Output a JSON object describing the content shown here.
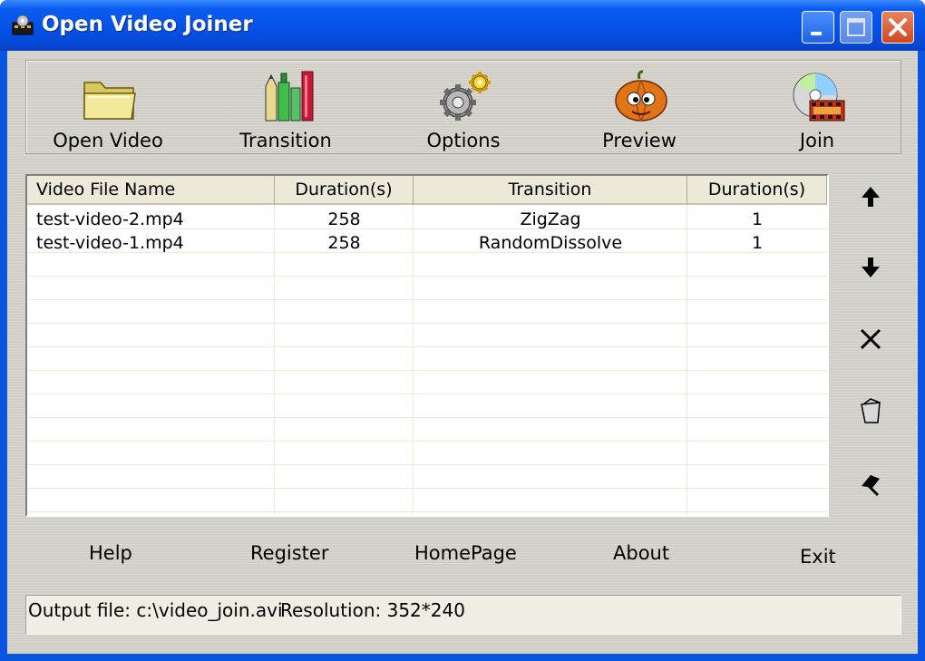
{
  "window": {
    "title": "Open Video Joiner"
  },
  "toolbar": {
    "open_video": "Open Video",
    "transition": "Transition",
    "options": "Options",
    "preview": "Preview",
    "join": "Join"
  },
  "table": {
    "columns": [
      "Video File Name",
      "Duration(s)",
      "Transition",
      "Duration(s)"
    ],
    "rows": [
      [
        "test-video-2.mp4",
        "258",
        "ZigZag",
        "1"
      ],
      [
        "test-video-1.mp4",
        "258",
        "RandomDissolve",
        "1"
      ]
    ]
  },
  "side_buttons": [
    "arrow-up-icon",
    "arrow-down-icon",
    "delete-icon",
    "trash-icon",
    "clear-icon"
  ],
  "links": {
    "help": "Help",
    "register": "Register",
    "homepage": "HomePage",
    "about": "About",
    "exit": "Exit"
  },
  "status": {
    "output_file": "Output file: c:\\video_join.avi",
    "resolution": "Resolution: 352*240"
  },
  "colors": {
    "titlebar": "#0552e6",
    "client_bg": "#d6d4cc",
    "header_bg": "#ece9d8",
    "close_button": "#d1471f"
  }
}
